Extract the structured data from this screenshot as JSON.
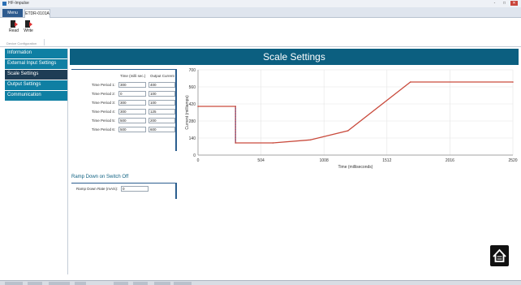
{
  "window": {
    "title": "HF-Impulse",
    "controls": [
      "-",
      "□",
      "✕"
    ]
  },
  "ribbon": {
    "file_tab": "Menu",
    "device_tab": "ETDR-0101A",
    "buttons": [
      {
        "label": "Read"
      },
      {
        "label": "Write"
      }
    ],
    "group_label": "Device Configuration"
  },
  "sidebar": {
    "items": [
      {
        "label": "Information",
        "active": false
      },
      {
        "label": "External Input Settings",
        "active": false
      },
      {
        "label": "Scale Settings",
        "active": true
      },
      {
        "label": "Output Settings",
        "active": false
      },
      {
        "label": "Communication",
        "active": false
      }
    ]
  },
  "main": {
    "title": "Scale Settings",
    "table": {
      "col_time": "Time (milli sec.)",
      "col_output": "Output Current",
      "rows": [
        {
          "label": "Time Period 1:",
          "time": "300",
          "output": "400"
        },
        {
          "label": "Time Period 2:",
          "time": "0",
          "output": "100"
        },
        {
          "label": "Time Period 3:",
          "time": "300",
          "output": "100"
        },
        {
          "label": "Time Period 4:",
          "time": "300",
          "output": "125"
        },
        {
          "label": "Time Period 5:",
          "time": "500",
          "output": "200"
        },
        {
          "label": "Time Period 6:",
          "time": "500",
          "output": "600"
        }
      ]
    },
    "ramp": {
      "title": "Ramp Down on Switch Off",
      "label": "Ramp Down Rate (mA/s):",
      "value": "0"
    }
  },
  "chart_data": {
    "type": "line",
    "title": "",
    "xlabel": "Time (milliseconds)",
    "ylabel": "Current (milliamps)",
    "xlim": [
      0,
      2520
    ],
    "ylim": [
      0,
      700
    ],
    "x_ticks": [
      "0",
      "504",
      "1008",
      "1512",
      "2016",
      "2520"
    ],
    "y_ticks": [
      "0",
      "140",
      "280",
      "420",
      "560",
      "700"
    ],
    "grid": true,
    "x": [
      0,
      300,
      300,
      600,
      900,
      1200,
      1700,
      2520
    ],
    "y": [
      400,
      400,
      100,
      100,
      125,
      200,
      600,
      600
    ],
    "colors": {
      "line": "#c94a3c",
      "step": "#3b3b9a"
    }
  },
  "home_icon": "home-icon",
  "colors": {
    "nav": "#0f7fa3",
    "nav_active": "#1e3d55",
    "header": "#0c5f80"
  }
}
